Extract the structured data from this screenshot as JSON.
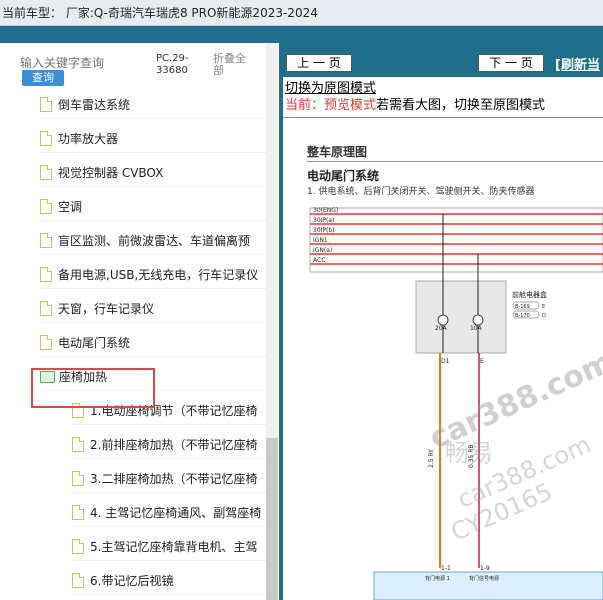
{
  "header": {
    "title": "当前车型：  厂家:Q-奇瑞汽车瑞虎8 PRO新能源2023-2024"
  },
  "search": {
    "placeholder": "输入关键字查询",
    "button_label": "查询",
    "pc_code": "PC.29-33680",
    "collapse_label": "折叠全部"
  },
  "tree": [
    {
      "label": "倒车雷达系统",
      "type": "file"
    },
    {
      "label": "功率放大器",
      "type": "file"
    },
    {
      "label": "视觉控制器 CVBOX",
      "type": "file"
    },
    {
      "label": "空调",
      "type": "file"
    },
    {
      "label": "盲区监测、前微波雷达、车道偏离预",
      "type": "file"
    },
    {
      "label": "备用电源,USB,无线充电，行车记录仪",
      "type": "file"
    },
    {
      "label": "天窗，行车记录仪",
      "type": "file"
    },
    {
      "label": "电动尾门系统",
      "type": "file",
      "selected": true
    },
    {
      "label": "座椅加热",
      "type": "folder"
    },
    {
      "label": "1.电动座椅调节（不带记忆座椅",
      "type": "file"
    },
    {
      "label": "2.前排座椅加热（不带记忆座椅",
      "type": "file"
    },
    {
      "label": "3.二排座椅加热（不带记忆座椅",
      "type": "file"
    },
    {
      "label": "4. 主驾记忆座椅通风、副驾座椅",
      "type": "file"
    },
    {
      "label": "5.主驾记忆座椅靠背电机、主驾",
      "type": "file"
    },
    {
      "label": "6.带记忆后视镜",
      "type": "file"
    }
  ],
  "viewer": {
    "prev_label": "上 一 页",
    "next_label": "下 一 页",
    "refresh_label": "[刷新当",
    "switch_link": "切换为原图模式",
    "current_prefix": "当前：预览模式",
    "current_suffix": "若需看大图，切换至原图模式",
    "section_title": "整车原理图",
    "diagram_title": "电动尾门系统",
    "diagram_subtitle": "1. 供电系统、后背门关闭开关、驾驶侧开关、防夹传感器",
    "watermarks": [
      "car388.com",
      "畅易",
      "car388.com",
      "CY20165"
    ],
    "diagram": {
      "rails": [
        "30(ENG)",
        "30IP(a)",
        "30IP(b)",
        "IGN1",
        "IGN(a)",
        "ACC"
      ],
      "box_label": "前舱电器盒",
      "b169": "B-169",
      "b169_pin": "E",
      "b170": "B-170",
      "b170_pin": "D",
      "fuse1": "20A",
      "fuse2": "10A",
      "pin_d1": "D1",
      "pin_e": "E",
      "wire1": "2.5 RY",
      "wire2": "0.35 RB",
      "pin1": "1-1",
      "pin2": "1-9",
      "conn1": "背门电源 1",
      "conn2": "背门信号电源"
    }
  },
  "colors": {
    "accent_blue": "#1f6f8b",
    "highlight_red": "#d94a4a",
    "link_red": "#e53935"
  }
}
